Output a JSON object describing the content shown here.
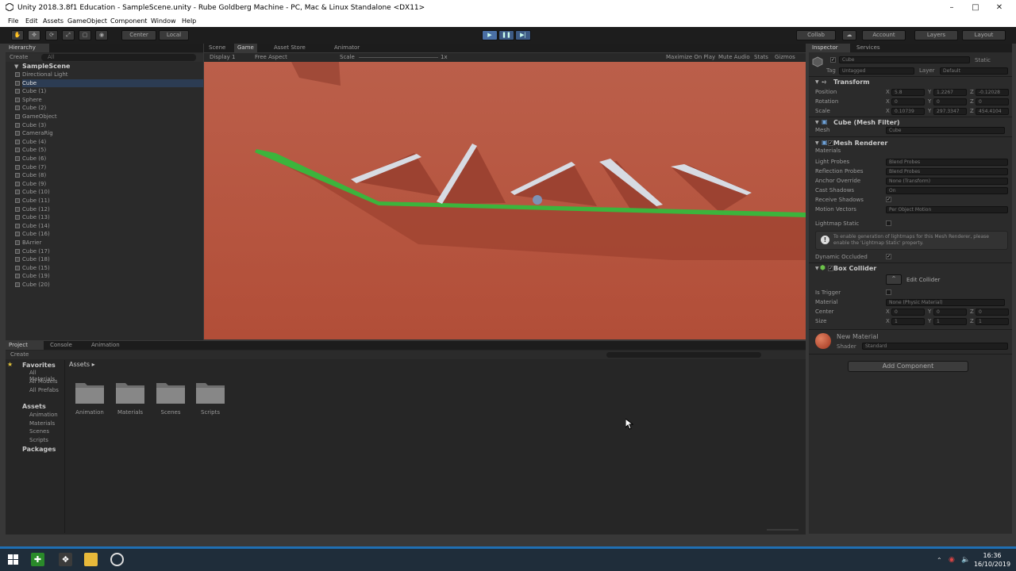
{
  "window": {
    "title": "Unity 2018.3.8f1 Education - SampleScene.unity - Rube Goldberg Machine - PC, Mac & Linux Standalone <DX11>"
  },
  "menu": [
    "File",
    "Edit",
    "Assets",
    "GameObject",
    "Component",
    "Window",
    "Help"
  ],
  "toolbar": {
    "pivot": "Center",
    "space": "Local",
    "collab": "Collab",
    "account": "Account",
    "layers": "Layers",
    "layout": "Layout"
  },
  "hierarchy": {
    "tab": "Hierarchy",
    "create": "Create",
    "search_placeholder": "All",
    "scene": "SampleScene",
    "items": [
      "Directional Light",
      "Cube",
      "Cube (1)",
      "Sphere",
      "Cube (2)",
      "GameObject",
      "Cube (3)",
      "CameraRig",
      "Cube (4)",
      "Cube (5)",
      "Cube (6)",
      "Cube (7)",
      "Cube (8)",
      "Cube (9)",
      "Cube (10)",
      "Cube (11)",
      "Cube (12)",
      "Cube (13)",
      "Cube (14)",
      "Cube (16)",
      "BArrier",
      "Cube (17)",
      "Cube (18)",
      "Cube (15)",
      "Cube (19)",
      "Cube (20)"
    ]
  },
  "center_tabs": [
    "Scene",
    "Game",
    "Asset Store",
    "Animator"
  ],
  "game_bar": {
    "display": "Display 1",
    "aspect": "Free Aspect",
    "scale_label": "Scale",
    "scale_value": "1x",
    "maximize": "Maximize On Play",
    "mute": "Mute Audio",
    "stats": "Stats",
    "gizmos": "Gizmos"
  },
  "bottom_tabs": [
    "Project",
    "Console",
    "Animation"
  ],
  "project": {
    "create": "Create",
    "favorites": "Favorites",
    "fav_items": [
      "All Materials",
      "All Models",
      "All Prefabs"
    ],
    "assets": "Assets",
    "asset_tree": [
      "Animation",
      "Materials",
      "Scenes",
      "Scripts"
    ],
    "packages": "Packages",
    "breadcrumb": "Assets",
    "folders": [
      "Animation",
      "Materials",
      "Scenes",
      "Scripts"
    ]
  },
  "inspector": {
    "tabs": [
      "Inspector",
      "Services"
    ],
    "object_name": "Cube",
    "static": "Static",
    "tag_label": "Tag",
    "tag": "Untagged",
    "layer_label": "Layer",
    "layer": "Default",
    "transform": {
      "title": "Transform",
      "rows": [
        {
          "label": "Position",
          "x": "5.8",
          "y": "1.2267",
          "z": "-0.12028"
        },
        {
          "label": "Rotation",
          "x": "0",
          "y": "0",
          "z": "0"
        },
        {
          "label": "Scale",
          "x": "0.10739",
          "y": "297.3347",
          "z": "454.4104"
        }
      ]
    },
    "mesh_filter": {
      "title": "Cube (Mesh Filter)",
      "mesh_label": "Mesh",
      "mesh": "Cube"
    },
    "mesh_renderer": {
      "title": "Mesh Renderer",
      "materials": "Materials",
      "rows": [
        {
          "label": "Light Probes",
          "value": "Blend Probes"
        },
        {
          "label": "Reflection Probes",
          "value": "Blend Probes"
        },
        {
          "label": "Anchor Override",
          "value": "None (Transform)"
        },
        {
          "label": "Cast Shadows",
          "value": "On"
        },
        {
          "label": "Receive Shadows",
          "value": ""
        },
        {
          "label": "Motion Vectors",
          "value": "Per Object Motion"
        }
      ],
      "lightmap_static": "Lightmap Static",
      "info": "To enable generation of lightmaps for this Mesh Renderer, please enable the 'Lightmap Static' property.",
      "dynamic_occluded": "Dynamic Occluded"
    },
    "box_collider": {
      "title": "Box Collider",
      "edit": "Edit Collider",
      "is_trigger": "Is Trigger",
      "material_label": "Material",
      "material": "None (Physic Material)",
      "center": {
        "label": "Center",
        "x": "0",
        "y": "0",
        "z": "0"
      },
      "size": {
        "label": "Size",
        "x": "1",
        "y": "1",
        "z": "1"
      }
    },
    "material": {
      "name": "New Material",
      "shader_label": "Shader",
      "shader": "Standard"
    },
    "add_component": "Add Component"
  },
  "taskbar": {
    "time": "16:36",
    "date": "16/10/2019"
  },
  "colors": {
    "green_ramp": "#3cb43c",
    "floor": "#b85a45"
  }
}
